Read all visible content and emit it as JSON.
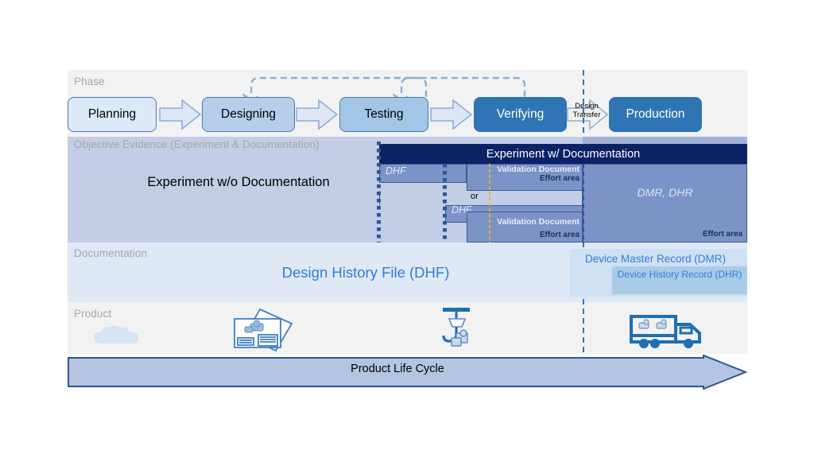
{
  "rows": {
    "phase": "Phase",
    "objective_evidence": "Objective Evidence (Experiment & Documentation)",
    "documentation": "Documentation",
    "product": "Product"
  },
  "phases": [
    {
      "label": "Planning"
    },
    {
      "label": "Designing"
    },
    {
      "label": "Testing"
    },
    {
      "label": "Verifying"
    },
    {
      "label": "Production"
    }
  ],
  "design_transfer": {
    "line1": "Design",
    "line2": "Transfer"
  },
  "objective_evidence": {
    "left_block_label": "Experiment w/o Documentation",
    "header_label": "Experiment w/ Documentation",
    "dhf_upper": "DHF",
    "dhf_lower": "DHF",
    "validation_document_upper": "Validation Document",
    "effort_area_upper": "Effort area",
    "or_label": "or",
    "validation_document_lower": "Validation Document",
    "effort_area_lower": "Effort area",
    "dmr_dhr": "DMR, DHR",
    "effort_area_right": "Effort area"
  },
  "documentation": {
    "dhf": "Design History File (DHF)",
    "dmr": "Device Master Record (DMR)",
    "dhr": "Device History Record (DHR)"
  },
  "product": {
    "icons": [
      "drawings-icon",
      "assembly-hook-icon",
      "delivery-truck-icon",
      "cloud-icon"
    ]
  },
  "lifecycle": {
    "label": "Product Life Cycle"
  },
  "colors": {
    "phase_band": "#f2f2f2",
    "oe_band": "#c3cde6",
    "doc_band": "#dfe8f5",
    "product_band": "#f2f2f2",
    "dark_navy": "#0b2265",
    "mid_blue": "#7b93c6",
    "accent_blue": "#2f75b5",
    "link_blue": "#2f7ed8",
    "label_gray": "#a6a6a6",
    "orange_divider": "#f0b323"
  }
}
